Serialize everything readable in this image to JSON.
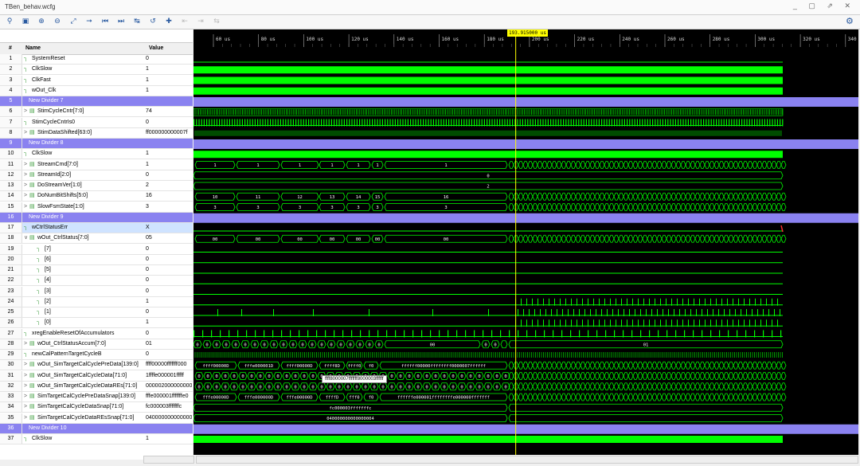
{
  "window": {
    "title": "TBen_behav.wcfg",
    "controls": "_ ▢ ⇗ ✕"
  },
  "toolbar": {
    "icons": [
      "search-icon",
      "save-icon",
      "zoom-in-icon",
      "zoom-out-icon",
      "zoom-fit-icon",
      "goto-cursor-icon",
      "goto-start-icon",
      "goto-end-icon",
      "prev-transition-icon",
      "next-transition-icon",
      "add-marker-icon",
      "prev-marker-icon",
      "next-marker-icon",
      "swap-cursors-icon"
    ]
  },
  "columns": {
    "num": "#",
    "name": "Name",
    "value": "Value"
  },
  "cursor": {
    "time_label": "193.915000 us"
  },
  "time_ruler": [
    "60 us",
    "80 us",
    "100 us",
    "120 us",
    "140 us",
    "160 us",
    "180 us",
    "200 us",
    "220 us",
    "240 us",
    "260 us",
    "280 us",
    "300 us",
    "320 us",
    "340 us"
  ],
  "signals": [
    {
      "n": "1",
      "name": "SystemReset",
      "value": "0",
      "kind": "bit"
    },
    {
      "n": "2",
      "name": "ClkSlow",
      "value": "1",
      "kind": "bit"
    },
    {
      "n": "3",
      "name": "ClkFast",
      "value": "1",
      "kind": "bit"
    },
    {
      "n": "4",
      "name": "wOut_Clk",
      "value": "1",
      "kind": "bit"
    },
    {
      "n": "5",
      "name": "New Divider 7",
      "value": "",
      "kind": "div"
    },
    {
      "n": "6",
      "name": "StimCycleCntr[7:0]",
      "value": "74",
      "kind": "bus"
    },
    {
      "n": "7",
      "name": "StimCycleCntrIs0",
      "value": "0",
      "kind": "bit"
    },
    {
      "n": "8",
      "name": "StimDataShifted[63:0]",
      "value": "ff000000000007f",
      "kind": "bus"
    },
    {
      "n": "9",
      "name": "New Divider 8",
      "value": "",
      "kind": "div"
    },
    {
      "n": "10",
      "name": "ClkSlow",
      "value": "1",
      "kind": "bit"
    },
    {
      "n": "11",
      "name": "StreamCmd[7:0]",
      "value": "1",
      "kind": "bus"
    },
    {
      "n": "12",
      "name": "StreamId[2:0]",
      "value": "0",
      "kind": "bus"
    },
    {
      "n": "13",
      "name": "DoStreamVer[1:0]",
      "value": "2",
      "kind": "bus"
    },
    {
      "n": "14",
      "name": "DoNumBitShifts[5:0]",
      "value": "16",
      "kind": "bus"
    },
    {
      "n": "15",
      "name": "SlowFsmState[1:0]",
      "value": "3",
      "kind": "bus"
    },
    {
      "n": "16",
      "name": "New Divider 9",
      "value": "",
      "kind": "div"
    },
    {
      "n": "17",
      "name": "wCtrlStatusErr",
      "value": "X",
      "kind": "bit",
      "sel": true
    },
    {
      "n": "18",
      "name": "wOut_CtrlStatus[7:0]",
      "value": "05",
      "kind": "bus",
      "open": true
    },
    {
      "n": "19",
      "name": "[7]",
      "value": "0",
      "kind": "sub"
    },
    {
      "n": "20",
      "name": "[6]",
      "value": "0",
      "kind": "sub"
    },
    {
      "n": "21",
      "name": "[5]",
      "value": "0",
      "kind": "sub"
    },
    {
      "n": "22",
      "name": "[4]",
      "value": "0",
      "kind": "sub"
    },
    {
      "n": "23",
      "name": "[3]",
      "value": "0",
      "kind": "sub"
    },
    {
      "n": "24",
      "name": "[2]",
      "value": "1",
      "kind": "sub"
    },
    {
      "n": "25",
      "name": "[1]",
      "value": "0",
      "kind": "sub"
    },
    {
      "n": "26",
      "name": "[0]",
      "value": "1",
      "kind": "sub"
    },
    {
      "n": "27",
      "name": "xregEnableResetOfAccumulators",
      "value": "0",
      "kind": "bit"
    },
    {
      "n": "28",
      "name": "wOut_CtrlStatusAccum[7:0]",
      "value": "01",
      "kind": "bus"
    },
    {
      "n": "29",
      "name": "newCalPatternTargetCycleB",
      "value": "0",
      "kind": "bit"
    },
    {
      "n": "30",
      "name": "wOut_SimTargetCalCyclePreData[139:0]",
      "value": "ffff00000fffffff000",
      "kind": "bus"
    },
    {
      "n": "31",
      "name": "wOut_SimTargetCalCycleData[71:0]",
      "value": "1ffffe000001fffff",
      "kind": "bus"
    },
    {
      "n": "32",
      "name": "wOut_SimTargetCalCycleDataREs[71:0]",
      "value": "000002000000000",
      "kind": "bus"
    },
    {
      "n": "33",
      "name": "SimTargetCalCyclePreDataSnap[139:0]",
      "value": "fffe000001fffffffe0",
      "kind": "bus"
    },
    {
      "n": "34",
      "name": "SimTargetCalCycleDataSnap[71:0]",
      "value": "fc000003fffffffc",
      "kind": "bus"
    },
    {
      "n": "35",
      "name": "SimTargetCalCycleDataREsSnap[71:0]",
      "value": "040000000000000",
      "kind": "bus"
    },
    {
      "n": "36",
      "name": "New Divider 10",
      "value": "",
      "kind": "div"
    },
    {
      "n": "37",
      "name": "ClkSlow",
      "value": "1",
      "kind": "bit"
    }
  ],
  "bus_labels": {
    "r11": [
      "1",
      "1",
      "1",
      "1",
      "1",
      "1",
      "1"
    ],
    "r12": [
      "0"
    ],
    "r13": [
      "2"
    ],
    "r14": [
      "10",
      "11",
      "12",
      "13",
      "14",
      "15",
      "16"
    ],
    "r15": [
      "3",
      "3",
      "3",
      "3",
      "3",
      "3",
      "3"
    ],
    "r18": [
      "00",
      "00",
      "00",
      "00",
      "00",
      "00",
      "00"
    ],
    "r28": [
      "00",
      "01"
    ],
    "r30": [
      "ffff00000D",
      "fffe000001D",
      "ffff00000D",
      "ffff8D",
      "ffff0",
      "f0",
      "ffffff00000ffffffff0000007ffffff"
    ],
    "r31": [
      "0",
      "0",
      "0",
      "0",
      "0",
      "0"
    ],
    "r33": [
      "fffe00000D",
      "fffe000000D",
      "fffe00000D",
      "ffffD",
      "fff0",
      "f0",
      "ffffffe000001ffffffffe000000fffffff"
    ],
    "r34": [
      "fc000003fffffffc"
    ],
    "r35": [
      "040000000000000004"
    ]
  },
  "tooltip": "ffff8000007fffffff8000003ffffff",
  "colors": {
    "wave": "#00ff00",
    "bus": "#00ff00",
    "xstate": "#ff3030",
    "divider": "#8a82f0",
    "cursor": "#ffff00",
    "background": "#000000"
  }
}
